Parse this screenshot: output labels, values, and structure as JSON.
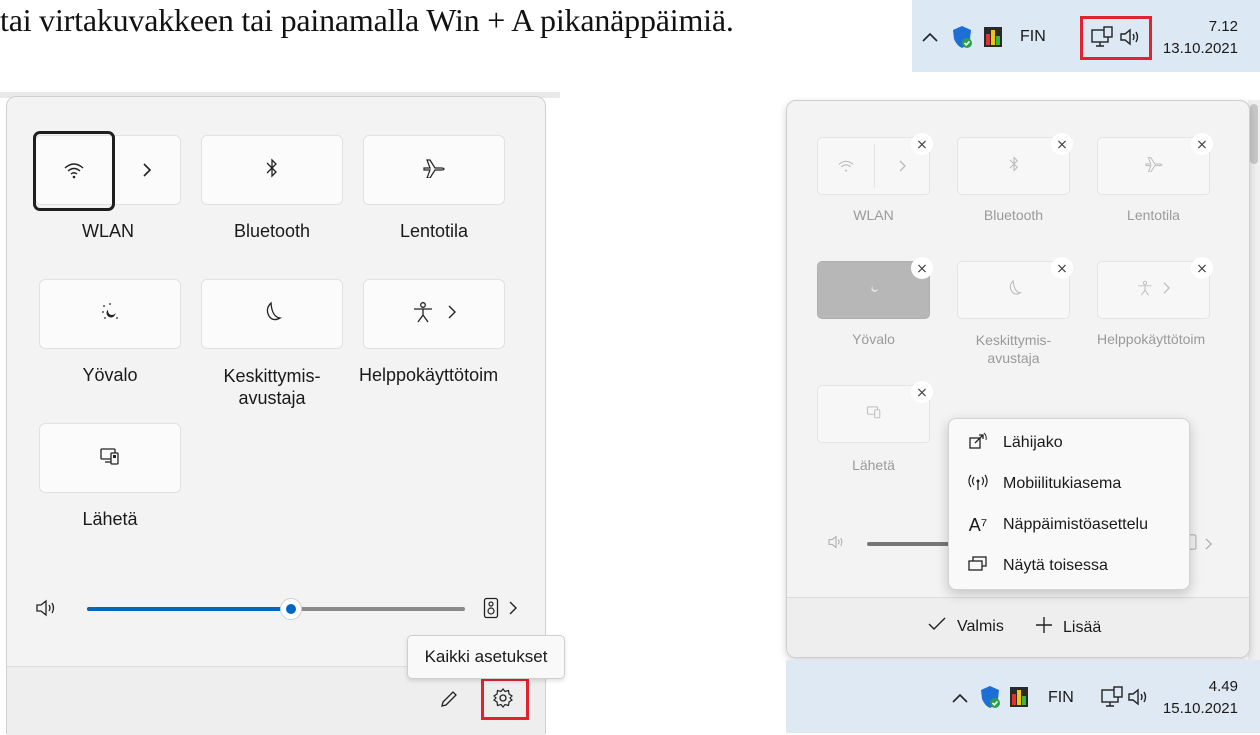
{
  "intro_text": "tai virtakuvakkeen tai painamalla Win + A pikanäppäimiä.",
  "taskbar_top": {
    "lang": "FIN",
    "time": "7.12",
    "date": "13.10.2021"
  },
  "taskbar_bottom": {
    "lang": "FIN",
    "time": "4.49",
    "date": "15.10.2021"
  },
  "left_panel": {
    "tiles": [
      {
        "label": "WLAN"
      },
      {
        "label": "Bluetooth"
      },
      {
        "label": "Lentotila"
      },
      {
        "label": "Yövalo"
      },
      {
        "label_line1": "Keskittymis-",
        "label_line2": "avustaja"
      },
      {
        "label": "Helppokäyttötoim"
      },
      {
        "label": "Lähetä"
      }
    ],
    "volume_percent": 54,
    "tooltip": "Kaikki asetukset"
  },
  "right_panel": {
    "tiles": [
      {
        "label": "WLAN"
      },
      {
        "label": "Bluetooth"
      },
      {
        "label": "Lentotila"
      },
      {
        "label": "Yövalo"
      },
      {
        "label_line1": "Keskittymis-",
        "label_line2": "avustaja"
      },
      {
        "label": "Helppokäyttötoim"
      },
      {
        "label": "Lähetä"
      }
    ],
    "menu": [
      {
        "label": "Lähijako",
        "icon": "share-icon"
      },
      {
        "label": "Mobiilitukiasema",
        "icon": "hotspot-icon"
      },
      {
        "label": "Näppäimistöasettelu",
        "icon": "keyboard-layout-icon"
      },
      {
        "label": "Näytä toisessa",
        "icon": "project-icon"
      }
    ],
    "done_label": "Valmis",
    "add_label": "Lisää"
  },
  "colors": {
    "accent": "#0067c0",
    "highlight": "#e0232e"
  }
}
